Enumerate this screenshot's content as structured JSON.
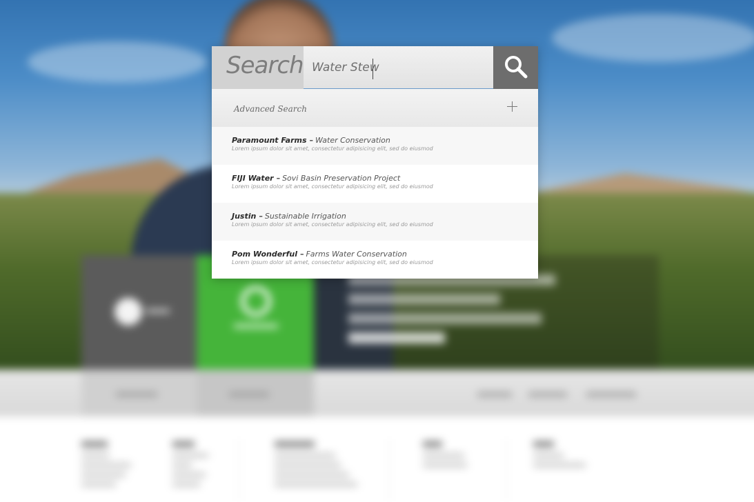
{
  "search": {
    "label": "Search:",
    "value": "Water Stew",
    "button_icon": "search-icon"
  },
  "advanced": {
    "label": "Advanced Search",
    "icon": "plus-icon"
  },
  "results": [
    {
      "organization": "Paramount Farms",
      "dash": "–",
      "project": "Water Conservation",
      "description": "Lorem ipsum dolor sit amet, consectetur adipisicing elit, sed do eiusmod"
    },
    {
      "organization": "FIJI Water",
      "dash": "–",
      "project": "Sovi Basin Preservation Project",
      "description": "Lorem ipsum dolor sit amet, consectetur adipisicing elit, sed do eiusmod"
    },
    {
      "organization": "Justin",
      "dash": "–",
      "project": "Sustainable Irrigation",
      "description": "Lorem ipsum dolor sit amet, consectetur adipisicing elit, sed do eiusmod"
    },
    {
      "organization": "Pom Wonderful",
      "dash": "–",
      "project": "Farms Water Conservation",
      "description": "Lorem ipsum dolor sit amet, consectetur adipisicing elit, sed do eiusmod"
    }
  ],
  "colors": {
    "label_box": "#d2d2d2",
    "button_bg": "#6d6d6d",
    "green_tile": "#45b43a",
    "grey_tile": "#5b5b5b"
  }
}
